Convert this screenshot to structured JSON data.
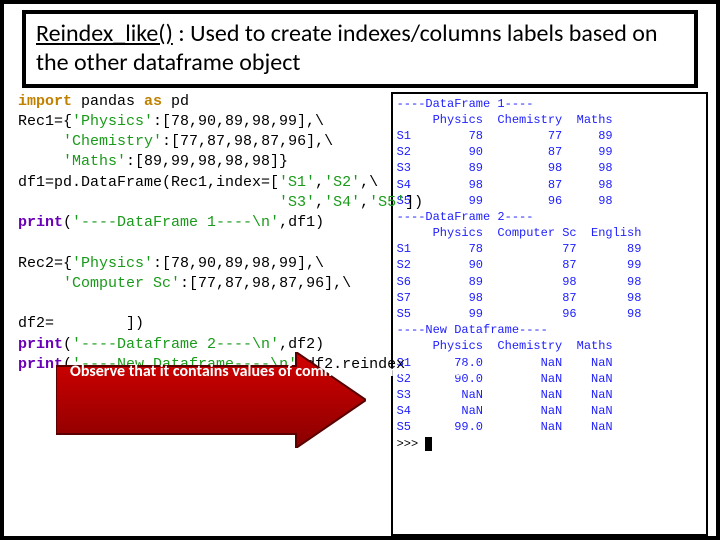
{
  "title": {
    "part1": "Reindex_like()",
    "part2": " : Used to create indexes/columns labels based on the other dataframe object"
  },
  "code": {
    "l1a": "import",
    "l1b": " pandas ",
    "l1c": "as",
    "l1d": " pd",
    "l2a": "Rec1={",
    "l2b": "'Physics'",
    "l2c": ":[78,90,89,98,99],\\",
    "l3a": "     ",
    "l3b": "'Chemistry'",
    "l3c": ":[77,87,98,87,96],\\",
    "l4a": "     ",
    "l4b": "'Maths'",
    "l4c": ":[89,99,98,98,98]}",
    "l5a": "df1=pd.DataFrame(Rec1,index=[",
    "l5b": "'S1'",
    "l5c": ",",
    "l5d": "'S2'",
    "l5e": ",\\",
    "l6a": "                             ",
    "l6b": "'S3'",
    "l6c": ",",
    "l6d": "'S4'",
    "l6e": ",",
    "l6f": "'S5'",
    "l6g": "])",
    "l7a": "print",
    "l7b": "(",
    "l7c": "'----DataFrame 1----\\n'",
    "l7d": ",df1)",
    "l8": " ",
    "l9a": "Rec2={",
    "l9b": "'Physics'",
    "l9c": ":[78,90,89,98,99],\\",
    "l10a": "     ",
    "l10b": "'Computer Sc'",
    "l10c": ":[77,87,98,87,96],\\",
    "l11": " ",
    "l12a": "df2=",
    "l12b": "        ",
    "l12c": "])",
    "l13a": "print",
    "l13b": "(",
    "l13c": "'----Dataframe 2----\\n'",
    "l13d": ",df2)",
    "l14a": "print",
    "l14b": "(",
    "l14c": "'----New Dataframe----\\n'",
    "l14d": ",df2.reindex"
  },
  "output": {
    "h1": "----DataFrame 1----",
    "t1": "     Physics  Chemistry  Maths\nS1        78         77     89\nS2        90         87     99\nS3        89         98     98\nS4        98         87     98\nS5        99         96     98",
    "h2": "----DataFrame 2----",
    "t2": "     Physics  Computer Sc  English\nS1        78           77       89\nS2        90           87       99\nS6        89           98       98\nS7        98           87       98\nS5        99           96       98",
    "h3": "----New Dataframe----",
    "t3": "     Physics  Chemistry  Maths\nS1      78.0        NaN    NaN\nS2      90.0        NaN    NaN\nS3       NaN        NaN    NaN\nS4       NaN        NaN    NaN\nS5      99.0        NaN    NaN",
    "prompt": ">>> "
  },
  "callout": {
    "text": "Observe that it contains values of common column 'Physics'"
  }
}
